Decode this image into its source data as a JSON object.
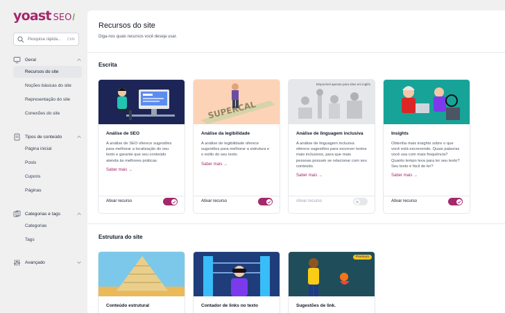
{
  "brand": {
    "name": "yoast",
    "product": "SEO",
    "slash": "/"
  },
  "search": {
    "placeholder": "Pesquisa rápida...",
    "shortcut": "Ctrlk"
  },
  "sidebar": {
    "groups": [
      {
        "label": "Geral",
        "items": [
          "Recursos do site",
          "Noções básicas do site",
          "Representação do site",
          "Conexões do site"
        ]
      },
      {
        "label": "Tipos de conteúdo",
        "items": [
          "Página inicial",
          "Posts",
          "Cupons",
          "Páginas"
        ]
      },
      {
        "label": "Categorias e tags",
        "items": [
          "Categorias",
          "Tags"
        ]
      },
      {
        "label": "Avançado",
        "items": []
      }
    ]
  },
  "page": {
    "title": "Recursos do site",
    "subtitle": "Diga-nos quais recursos você deseja usar."
  },
  "sections": {
    "writing": "Escrita",
    "structure": "Estrutura do site"
  },
  "cards": [
    {
      "title": "Análise de SEO",
      "desc": "A análise de SEO oferece sugestões para melhorar a localização do seu texto e garante que seu conteúdo atenda às melhores práticas.",
      "more": "Saber mais →",
      "action": "Ativar recurso",
      "enabled": true
    },
    {
      "title": "Análise da legibilidade",
      "desc": "A análise de legibilidade oferece sugestões para melhorar a estrutura e o estilo do seu texto.",
      "more": "Saber mais →",
      "action": "Ativar recurso",
      "enabled": true
    },
    {
      "title": "Análise de linguagem inclusiva",
      "badge": "Disponível apenas para sites em inglês",
      "desc": "A análise de linguagem inclusiva oferece sugestões para escrever textos mais inclusivos, para que mais pessoas possam se relacionar com seu conteúdo.",
      "more": "Saber mais →",
      "action": "Ativar recurso",
      "enabled": false
    },
    {
      "title": "Insights",
      "desc": "Obtenha mais insights sobre o que você está escrevendo. Quais palavras você usa com mais frequência? Quanto tempo leva para ler seu texto? Seu texto é fácil de ler?",
      "more": "Saber mais →",
      "action": "Ativar recurso",
      "enabled": true
    }
  ],
  "structure_cards": [
    {
      "title": "Conteúdo estrutural"
    },
    {
      "title": "Contador de links no texto"
    },
    {
      "title": "Sugestões de link.",
      "premium": "Premium"
    }
  ],
  "colors": {
    "brand": "#a4286a",
    "accent_green": "#77b227"
  }
}
